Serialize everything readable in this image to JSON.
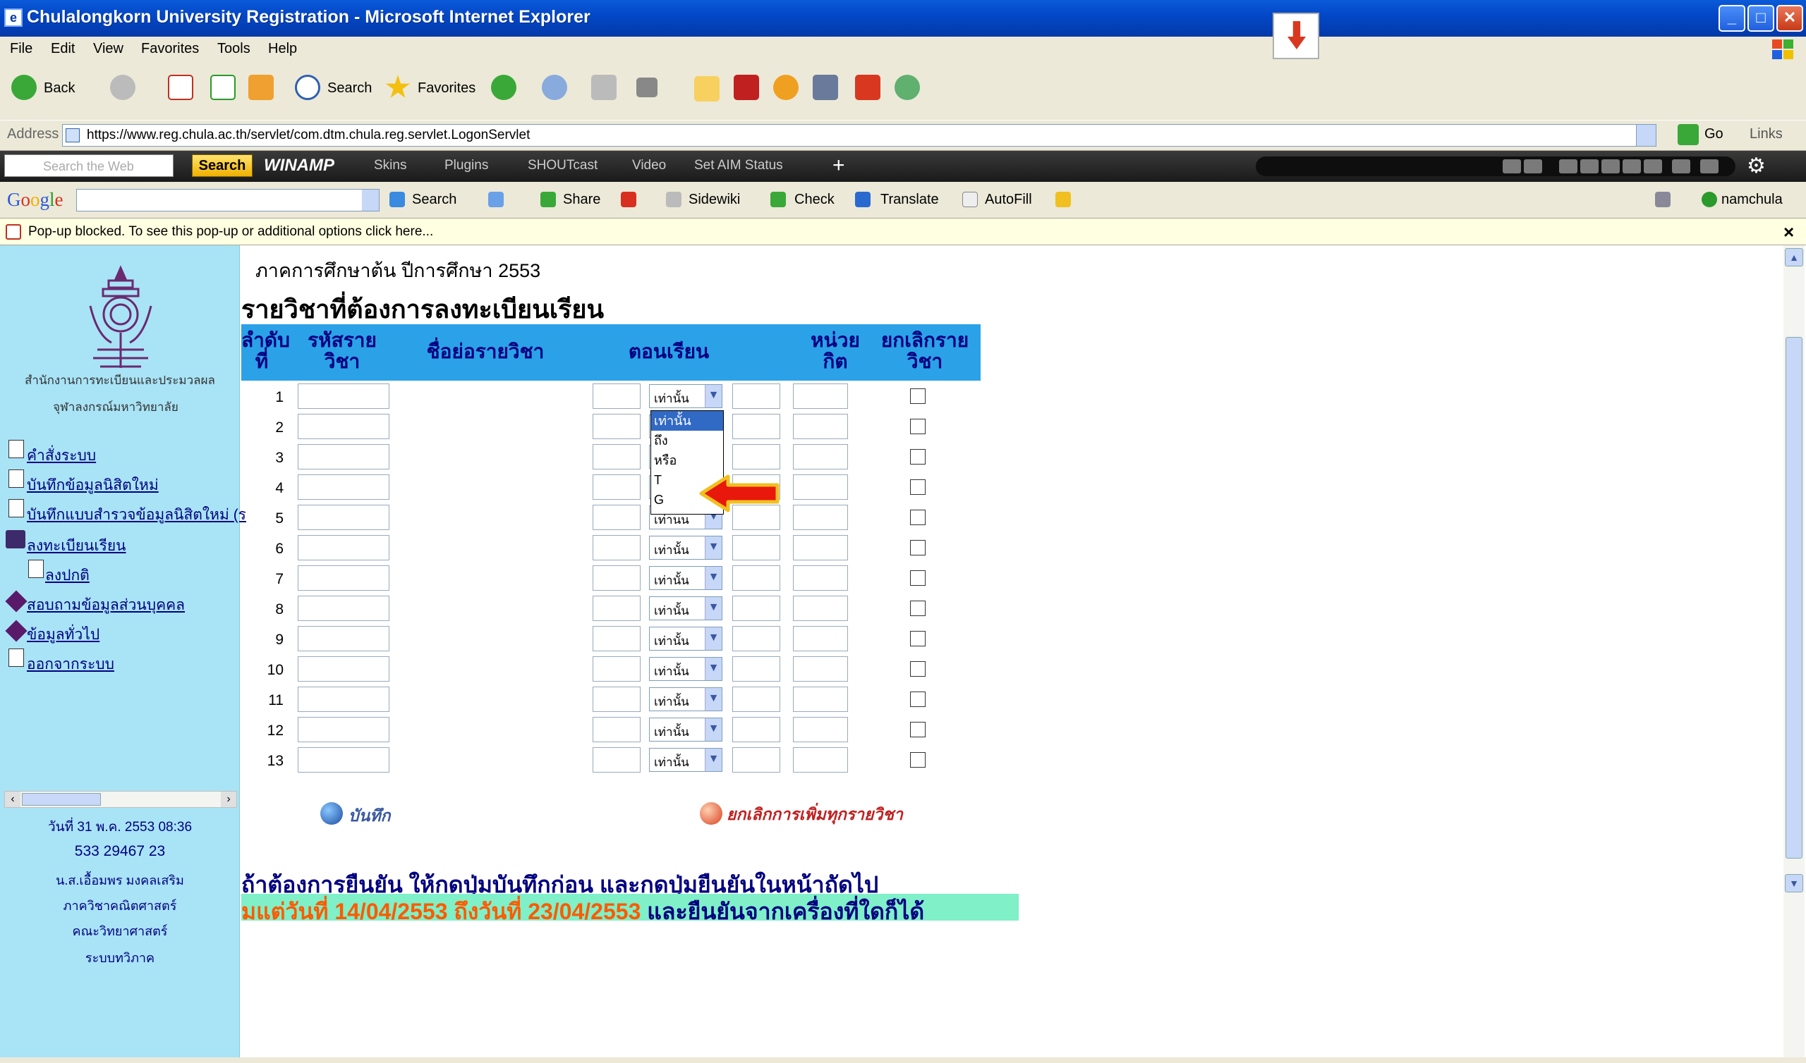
{
  "window": {
    "title": "Chulalongkorn University Registration - Microsoft Internet Explorer"
  },
  "menu": [
    "File",
    "Edit",
    "View",
    "Favorites",
    "Tools",
    "Help"
  ],
  "toolbar": {
    "back": "Back",
    "search": "Search",
    "favorites": "Favorites"
  },
  "address": {
    "label": "Address",
    "url": "https://www.reg.chula.ac.th/servlet/com.dtm.chula.reg.servlet.LogonServlet",
    "go": "Go",
    "links": "Links"
  },
  "winamp": {
    "search_placeholder": "Search the Web",
    "search_button": "Search",
    "logo": "WINAMP",
    "items": [
      "Skins",
      "Plugins",
      "SHOUTcast",
      "Video",
      "Set AIM Status"
    ]
  },
  "google": {
    "logo": "Google",
    "items": [
      "Search",
      "Share",
      "Sidewiki",
      "Check",
      "Translate",
      "AutoFill"
    ],
    "user": "namchula"
  },
  "infobar": {
    "text": "Pop-up blocked. To see this pop-up or additional options click here..."
  },
  "sidebar": {
    "org_line1": "สำนักงานการทะเบียนและประมวลผล",
    "org_line2": "จุฬาลงกรณ์มหาวิทยาลัย",
    "links": [
      "คำสั่งระบบ",
      "บันทึกข้อมูลนิสิตใหม่",
      "บันทึกแบบสำรวจข้อมูลนิสิตใหม่ (ร",
      "ลงทะเบียนเรียน",
      "ลงปกติ",
      "สอบถามข้อมูลส่วนบุคคล",
      "ข้อมูลทั่วไป",
      "ออกจากระบบ"
    ],
    "date": "วันที่ 31 พ.ค. 2553 08:36",
    "student_id": "533 29467 23",
    "name": "น.ส.เอื้อมพร มงคลเสริม",
    "department": "ภาควิชาคณิตศาสตร์",
    "faculty": "คณะวิทยาศาสตร์",
    "program": "ระบบทวิภาค"
  },
  "main": {
    "term": "ภาคการศึกษาต้น   ปีการศึกษา 2553",
    "heading": "รายวิชาที่ต้องการลงทะเบียนเรียน",
    "headers": {
      "no1": "ลำดับ",
      "no2": "ที่",
      "code1": "รหัสราย",
      "code2": "วิชา",
      "name": "ชื่อย่อรายวิชา",
      "section": "ตอนเรียน",
      "credit1": "หน่วย",
      "credit2": "กิต",
      "cancel1": "ยกเลิกราย",
      "cancel2": "วิชา"
    },
    "row_numbers": [
      "1",
      "2",
      "3",
      "4",
      "5",
      "6",
      "7",
      "8",
      "9",
      "10",
      "11",
      "12",
      "13"
    ],
    "select_value": "เท่านั้น",
    "select_value_short": "เท่านน",
    "dropdown_options": [
      "เท่านั้น",
      "ถึง",
      "หรือ",
      "T",
      "G"
    ],
    "save_label": "บันทึก",
    "cancel_all_label": "ยกเลิกการเพิ่มทุกรายวิชา",
    "note1": "ถ้าต้องการยืนยัน ให้กดปุ่มบันทึกก่อน และกดปุ่มยืนยันในหน้าถัดไป",
    "note2_red": "มแต่วันที่ 14/04/2553 ถึงวันที่ 23/04/2553",
    "note2_blue": "  และยืนยันจากเครื่องที่ใดก็ได้"
  },
  "colors": {
    "header_bg": "#2ba1e8",
    "sidebar_bg": "#a9e3f6",
    "note_bg": "#7ff0c8",
    "arrow": "#e8180c"
  }
}
